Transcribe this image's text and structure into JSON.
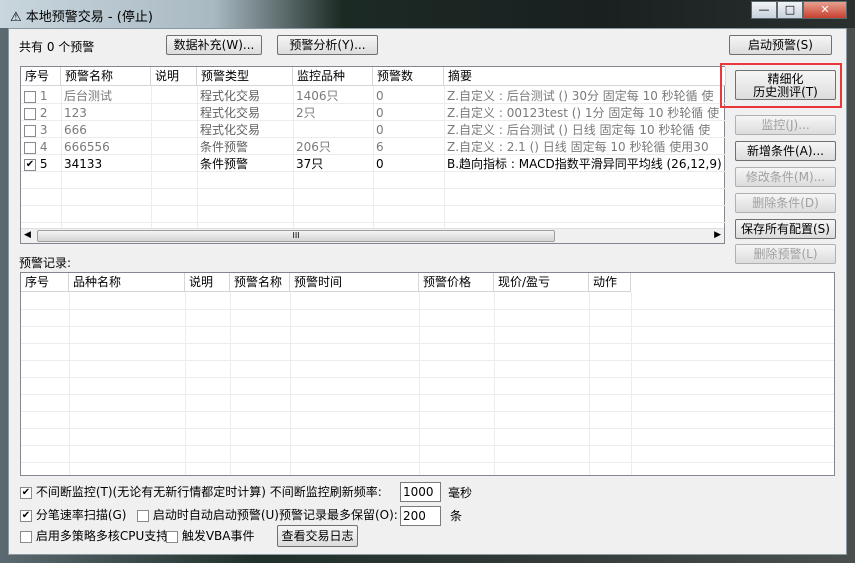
{
  "window": {
    "title": "本地预警交易 - (停止)",
    "minimize": "—",
    "maximize": "□",
    "close": "✕"
  },
  "toolbar": {
    "count_text": "共有 0 个预警",
    "data_fill": "数据补充(W)...",
    "analysis": "预警分析(Y)...",
    "start": "启动预警(S)"
  },
  "alerts": {
    "columns": [
      "序号",
      "预警名称",
      "说明",
      "预警类型",
      "监控品种",
      "预警数",
      "摘要"
    ],
    "rows": [
      {
        "checked": false,
        "id": "1",
        "name": "后台测试",
        "desc": "",
        "type": "程式化交易",
        "symbols": "1406只",
        "count": "0",
        "summary": "Z.自定义 : 后台测试 () 30分 固定每 10 秒轮循 使",
        "active": false
      },
      {
        "checked": false,
        "id": "2",
        "name": "123",
        "desc": "",
        "type": "程式化交易",
        "symbols": "2只",
        "count": "0",
        "summary": "Z.自定义 : 00123test () 1分 固定每 10 秒轮循 使",
        "active": false
      },
      {
        "checked": false,
        "id": "3",
        "name": "666",
        "desc": "",
        "type": "程式化交易",
        "symbols": "",
        "count": "0",
        "summary": "Z.自定义 : 后台测试 () 日线 固定每 10 秒轮循 使",
        "active": false
      },
      {
        "checked": false,
        "id": "4",
        "name": "666556",
        "desc": "",
        "type": "条件预警",
        "symbols": "206只",
        "count": "6",
        "summary": "Z.自定义 : 2.1 () 日线 固定每 10 秒轮循 使用30",
        "active": false
      },
      {
        "checked": true,
        "id": "5",
        "name": "34133",
        "desc": "",
        "type": "条件预警",
        "symbols": "37只",
        "count": "0",
        "summary": "B.趋向指标 : MACD指数平滑异同平均线 (26,12,9)",
        "active": true
      }
    ],
    "scroll_grip": "III"
  },
  "side": {
    "refine_1": "精细化",
    "refine_2": "历史测评(T)",
    "monitor": "监控(J)...",
    "add": "新增条件(A)...",
    "edit": "修改条件(M)...",
    "delete_cond": "删除条件(D)",
    "save": "保存所有配置(S)",
    "delete_alert": "删除预警(L)"
  },
  "records": {
    "label": "预警记录:",
    "columns": [
      "序号",
      "品种名称",
      "说明",
      "预警名称",
      "预警时间",
      "预警价格",
      "现价/盈亏",
      "动作"
    ]
  },
  "options": {
    "continuous": "不间断监控(T)(无论有无新行情都定时计算) 不间断监控刷新频率:",
    "freq": "1000",
    "freq_unit": "毫秒",
    "tick_scan": "分笔速率扫描(G)",
    "auto_start": "启动时自动启动预警(U)",
    "max_keep": "预警记录最多保留(O):",
    "keep": "200",
    "keep_unit": "条",
    "multicore": "启用多策略多核CPU支持",
    "vba": "触发VBA事件",
    "view_log": "查看交易日志"
  },
  "colors": {
    "highlight": "#e8383a"
  }
}
